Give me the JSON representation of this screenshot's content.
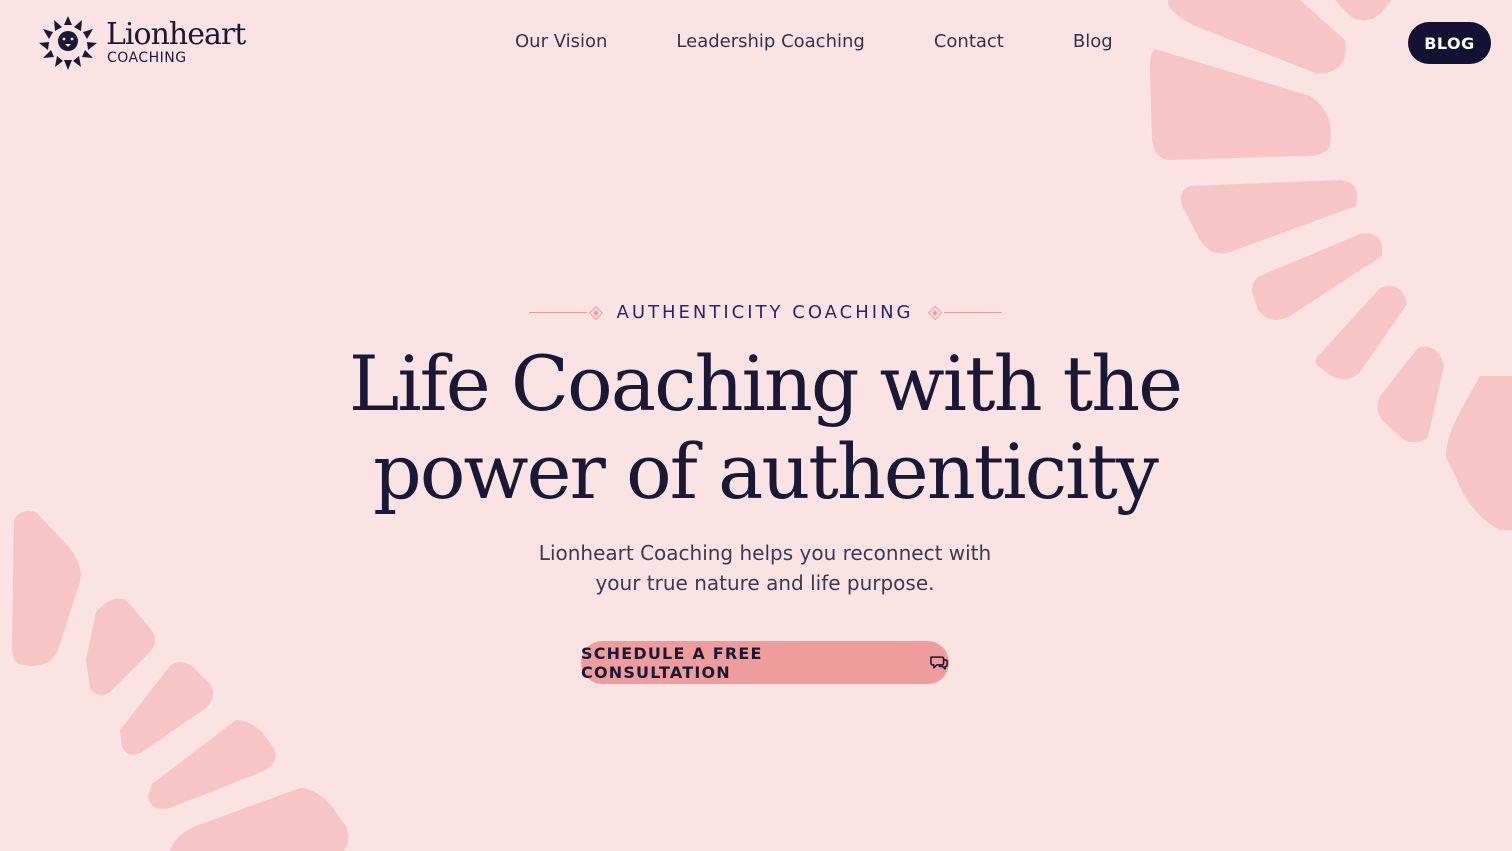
{
  "brand": {
    "name": "Lionheart",
    "subtitle": "COACHING",
    "logo_icon": "lion-head-icon"
  },
  "nav": {
    "items": [
      {
        "label": "Our Vision"
      },
      {
        "label": "Leadership Coaching"
      },
      {
        "label": "Contact"
      },
      {
        "label": "Blog"
      }
    ],
    "cta_label": "BLOG"
  },
  "hero": {
    "eyebrow": "AUTHENTICITY COACHING",
    "headline_line1": "Life Coaching with the",
    "headline_line2": "power of authenticity",
    "subtext_line1": "Lionheart Coaching helps you reconnect with",
    "subtext_line2": "your true nature and life purpose.",
    "cta_label": "SCHEDULE A FREE CONSULTATION",
    "cta_icon": "chat-bubbles-icon"
  },
  "colors": {
    "background": "#fae3e2",
    "decor": "#f7c5c5",
    "navy": "#141233",
    "accent": "#ef9c9c"
  }
}
